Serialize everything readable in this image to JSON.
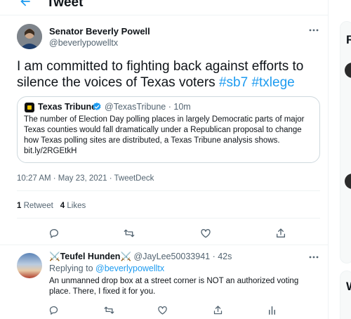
{
  "header": {
    "title": "Tweet"
  },
  "tweet": {
    "author_name": "Senator Beverly Powell",
    "author_handle": "@beverlypowelltx",
    "text_main": "I am committed to fighting back against efforts to silence the voices of Texas voters ",
    "hashtags": [
      "#sb7",
      "#txlege"
    ],
    "timestamp": "10:27 AM · May 23, 2021 · TweetDeck",
    "retweet_count": "1",
    "retweet_label": "Retweet",
    "like_count": "4",
    "like_label": "Likes"
  },
  "quote": {
    "name": "Texas Tribune",
    "meta": "@TexasTribune · 10m",
    "text": "The number of Election Day polling places in largely Democratic parts of major Texas counties would fall dramatically under a Republican proposal to change how Texas polling sites are distributed, a Texas Tribune analysis shows. bit.ly/2RGEtkH"
  },
  "reply": {
    "name": "⚔️Teufel Hunden⚔️",
    "meta": "@JayLee50033941 · 42s",
    "replying_prefix": "Replying to ",
    "replying_to": "@beverlypowelltx",
    "text": "An unmanned drop box at a street corner is NOT an authorized voting place. There, I fixed it for you."
  },
  "sidebar": {
    "letters": [
      "R",
      "W"
    ]
  },
  "colors": {
    "accent": "#1d9bf0",
    "secondary_text": "#536471",
    "border": "#cfd9de"
  },
  "icons": [
    "back-arrow-icon",
    "more-icon",
    "verified-icon",
    "reply-icon",
    "retweet-icon",
    "like-icon",
    "share-icon",
    "analytics-icon"
  ]
}
